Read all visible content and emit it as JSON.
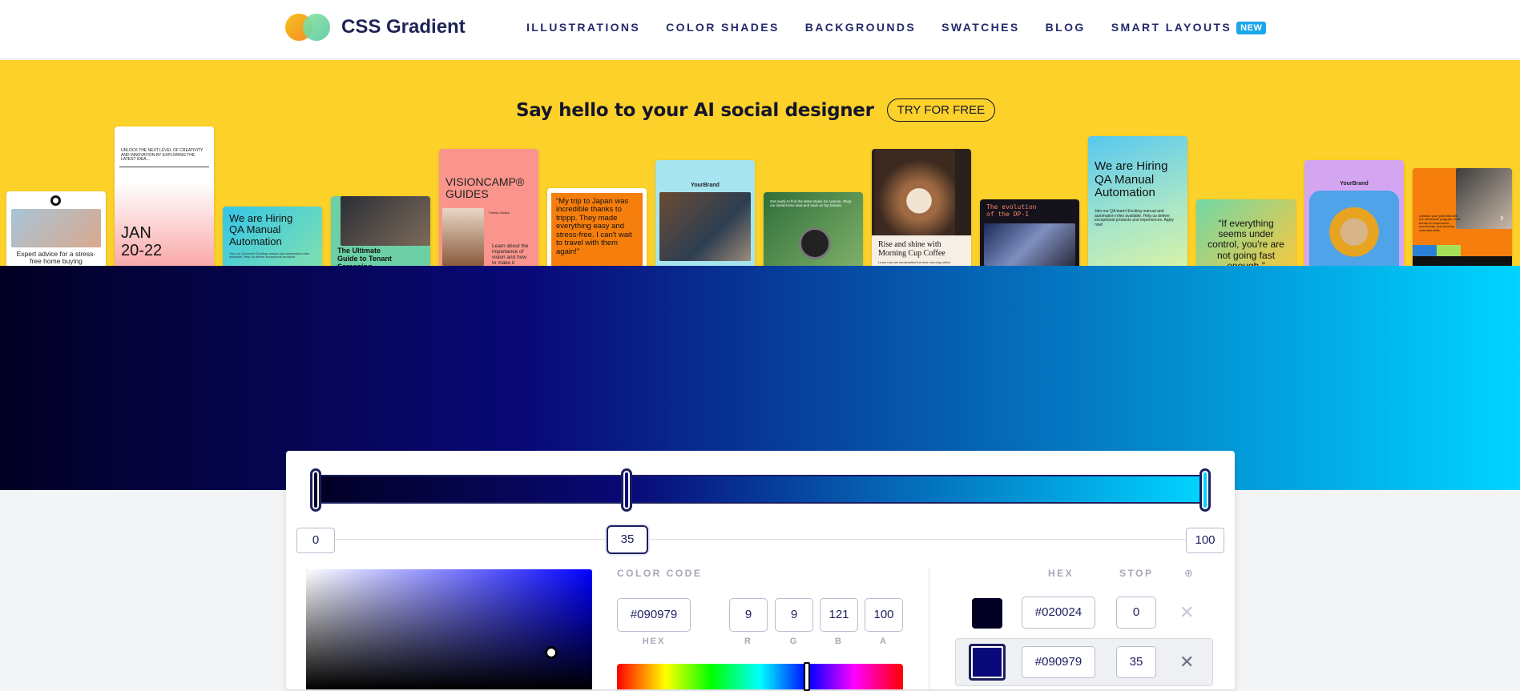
{
  "header": {
    "brand": "CSS Gradient",
    "nav": [
      "ILLUSTRATIONS",
      "COLOR SHADES",
      "BACKGROUNDS",
      "SWATCHES",
      "BLOG",
      "SMART LAYOUTS"
    ],
    "badge": "NEW"
  },
  "banner": {
    "title": "Say hello to your AI social designer",
    "cta": "TRY FOR FREE",
    "cards": [
      "Expert advice for a stress-free home buying experience",
      "UNLOCK THE NEXT LEVEL OF CREATIVITY AND INNOVATION BY EXPLORING THE LATEST IDEA...",
      "JAN 20-22",
      "We are Hiring QA Manual Automation",
      "Join our QA team! Exciting manual and automation roles available. Help us deliver exceptional products",
      "The Ultimate Guide to Tenant Screening",
      "VISIONCAMP® GUIDES",
      "Family Guides",
      "Learn about the importance of vision and how to make it",
      "“My trip to Japan was incredible thanks to trippp. They made everything easy and stress-free. I can't wait to travel with them again!”",
      "YourBrand",
      "Get ready to find the latest styles for Autumn. Shop our limited-time deal and save on top brands.",
      "Rise and shine with Morning Cup Coffee",
      "Learn how we handcrafted the best morning coffee",
      "The evolution of the DP-1",
      "We are Hiring QA Manual Automation",
      "Join our QA team! Exciting manual and automation roles available. Help us deliver exceptional products and experiences. Apply now!",
      "“If everything seems under control, you're are not going fast enough.”",
      "YourBrand",
      "Unleash your potential with our immersive program. Gain hands-on experience, mentorship, and develop essential skills."
    ]
  },
  "gradient": {
    "css": "linear-gradient(90deg, #020024 0%, #090979 35%, #00d4ff 100%)",
    "stops": [
      {
        "hex": "#020024",
        "stop": "0"
      },
      {
        "hex": "#090979",
        "stop": "35"
      },
      {
        "hex": "#00d4ff",
        "stop": "100"
      }
    ]
  },
  "editor": {
    "color_code_label": "COLOR CODE",
    "hex_value": "#090979",
    "r": "9",
    "g": "9",
    "b": "121",
    "a": "100",
    "hex_label": "HEX",
    "r_label": "R",
    "g_label": "G",
    "b_label": "B",
    "a_label": "A",
    "stops_hex_header": "HEX",
    "stops_stop_header": "STOP",
    "add_icon": "⊕",
    "delete_icon": "✕",
    "selected_stop": "35"
  },
  "colors": {
    "accent": "#1b1f5e",
    "banner_bg": "#fcd12a",
    "badge": "#1aa7ec"
  },
  "icons": [
    "plus-circle-icon",
    "close-icon"
  ]
}
